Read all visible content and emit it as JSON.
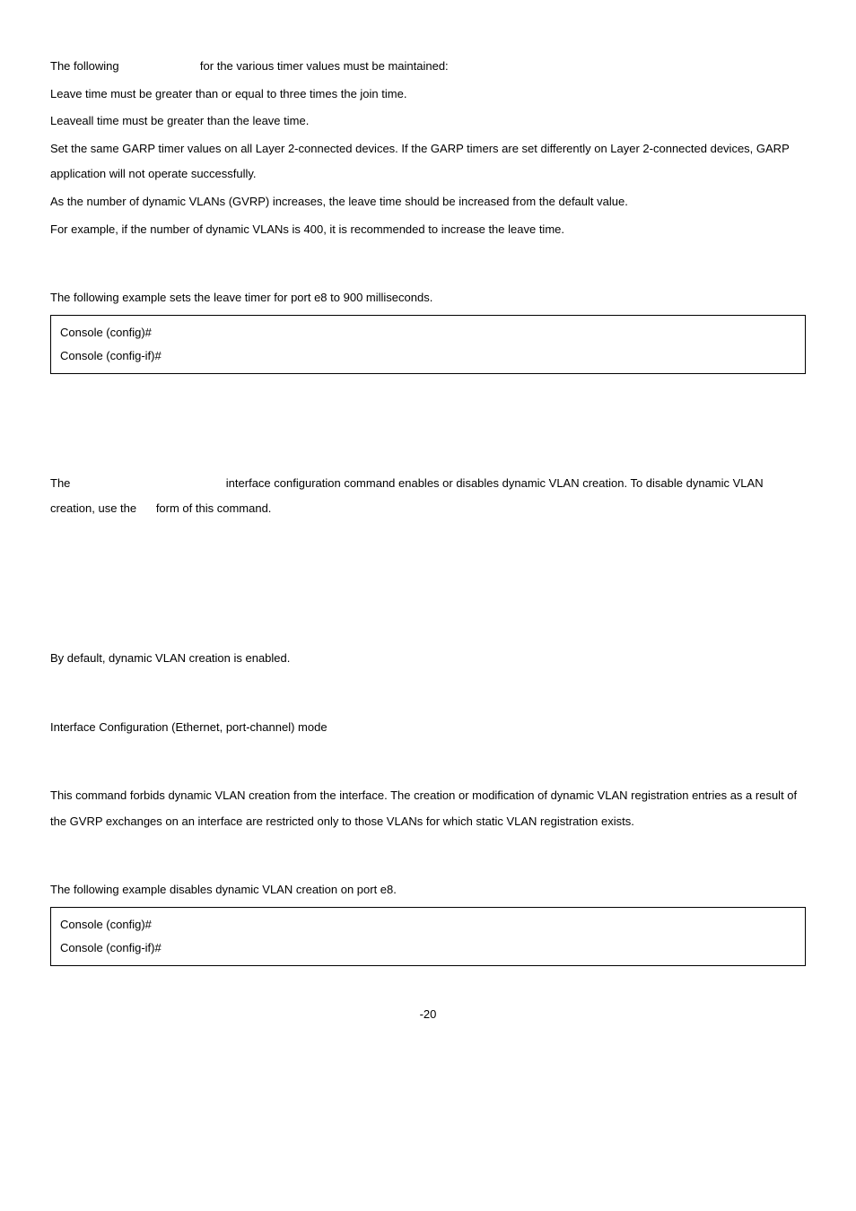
{
  "p1_a": "The following ",
  "p1_b": " for the various timer values must be maintained:",
  "p2": "Leave time must be greater than or equal to three times the join time.",
  "p3": "Leaveall time must be greater than the leave time.",
  "p4": "Set the same GARP timer values on all Layer 2-connected devices. If the GARP timers are set differently on Layer 2-connected devices, GARP application will not operate successfully.",
  "p5": "As the number of dynamic VLANs (GVRP) increases, the leave time should be increased from the default value.",
  "p6": "For example, if the number of dynamic VLANs is 400, it is recommended to increase the leave time.",
  "p7": "The following example sets the leave timer for port e8 to 900 milliseconds.",
  "cb1_l1": "Console (config)#",
  "cb1_l2": "Console (config-if)#",
  "p8_a": "The ",
  "p8_b": " interface configuration command enables or disables dynamic VLAN creation. To disable dynamic VLAN creation, use the ",
  "p8_c": " form of this command.",
  "p9": "By default, dynamic VLAN creation is enabled.",
  "p10": "Interface Configuration (Ethernet, port-channel) mode",
  "p11": "This command forbids dynamic VLAN creation from the interface. The creation or modification of dynamic VLAN registration entries as a result of the GVRP exchanges on an interface are restricted only to those VLANs for which static VLAN registration exists.",
  "p12": "The following example disables dynamic VLAN creation on port e8.",
  "cb2_l1": "Console (config)#",
  "cb2_l2": "Console (config-if)#",
  "pagenum": "-20"
}
